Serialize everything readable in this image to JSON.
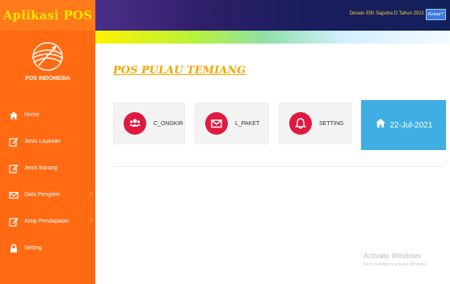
{
  "app": {
    "title": "Aplikasi POS"
  },
  "logo": {
    "text": "POS INDONESIA"
  },
  "sidebar": {
    "items": [
      {
        "label": "Home",
        "icon": "home-icon"
      },
      {
        "label": "Jenis Layanan",
        "icon": "edit-icon"
      },
      {
        "label": "Jenis Barang",
        "icon": "edit-icon"
      },
      {
        "label": "Data Pengirim",
        "icon": "envelope-icon",
        "has_submenu": true
      },
      {
        "label": "Arsip Pendapatan",
        "icon": "edit-icon",
        "has_submenu": true
      },
      {
        "label": "Setting",
        "icon": "lock-icon"
      }
    ]
  },
  "header": {
    "user_text": "Desain Elfri Saputra D Tahun 2021",
    "logout_label": "Keluar?"
  },
  "main": {
    "title": "POS PULAU TEMIANG",
    "cards": [
      {
        "label": "C_ONGKIR",
        "icon": "users-icon"
      },
      {
        "label": "L_PAKET",
        "icon": "envelope-icon"
      },
      {
        "label": "SETTING",
        "icon": "bell-icon"
      }
    ],
    "date": "22-Jul-2021"
  },
  "watermark": {
    "title": "Activate Windows",
    "subtitle": "Go to Settings to activate Windows."
  },
  "colors": {
    "sidebar": "#ff6a13",
    "brand_text": "#ffe600",
    "header": "#1a1e5e",
    "title": "#f0a800",
    "card_icon": "#e0193f",
    "date_card": "#3eaee3",
    "button": "#3a7be0"
  }
}
